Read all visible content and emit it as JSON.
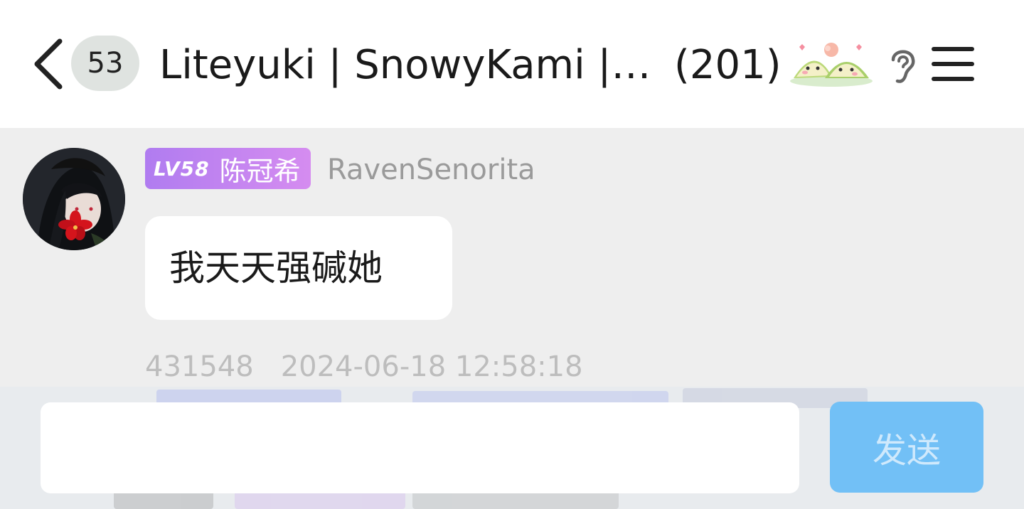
{
  "header": {
    "unread_count": "53",
    "title": "Liteyuki | SnowyKami |…",
    "member_count": "(201)"
  },
  "message": {
    "level": "LV58",
    "member_title": "陈冠希",
    "sender": "RavenSenorita",
    "text": "我天天强碱她",
    "sender_id": "431548",
    "timestamp": "2024-06-18 12:58:18"
  },
  "composer": {
    "input_value": "",
    "send_label": "发送"
  },
  "colors": {
    "level_badge": "#b07cf0",
    "send_button": "#72c0f6",
    "chat_background": "#eeeeee"
  },
  "icons": [
    "back-arrow-icon",
    "ear-icon",
    "menu-icon"
  ]
}
